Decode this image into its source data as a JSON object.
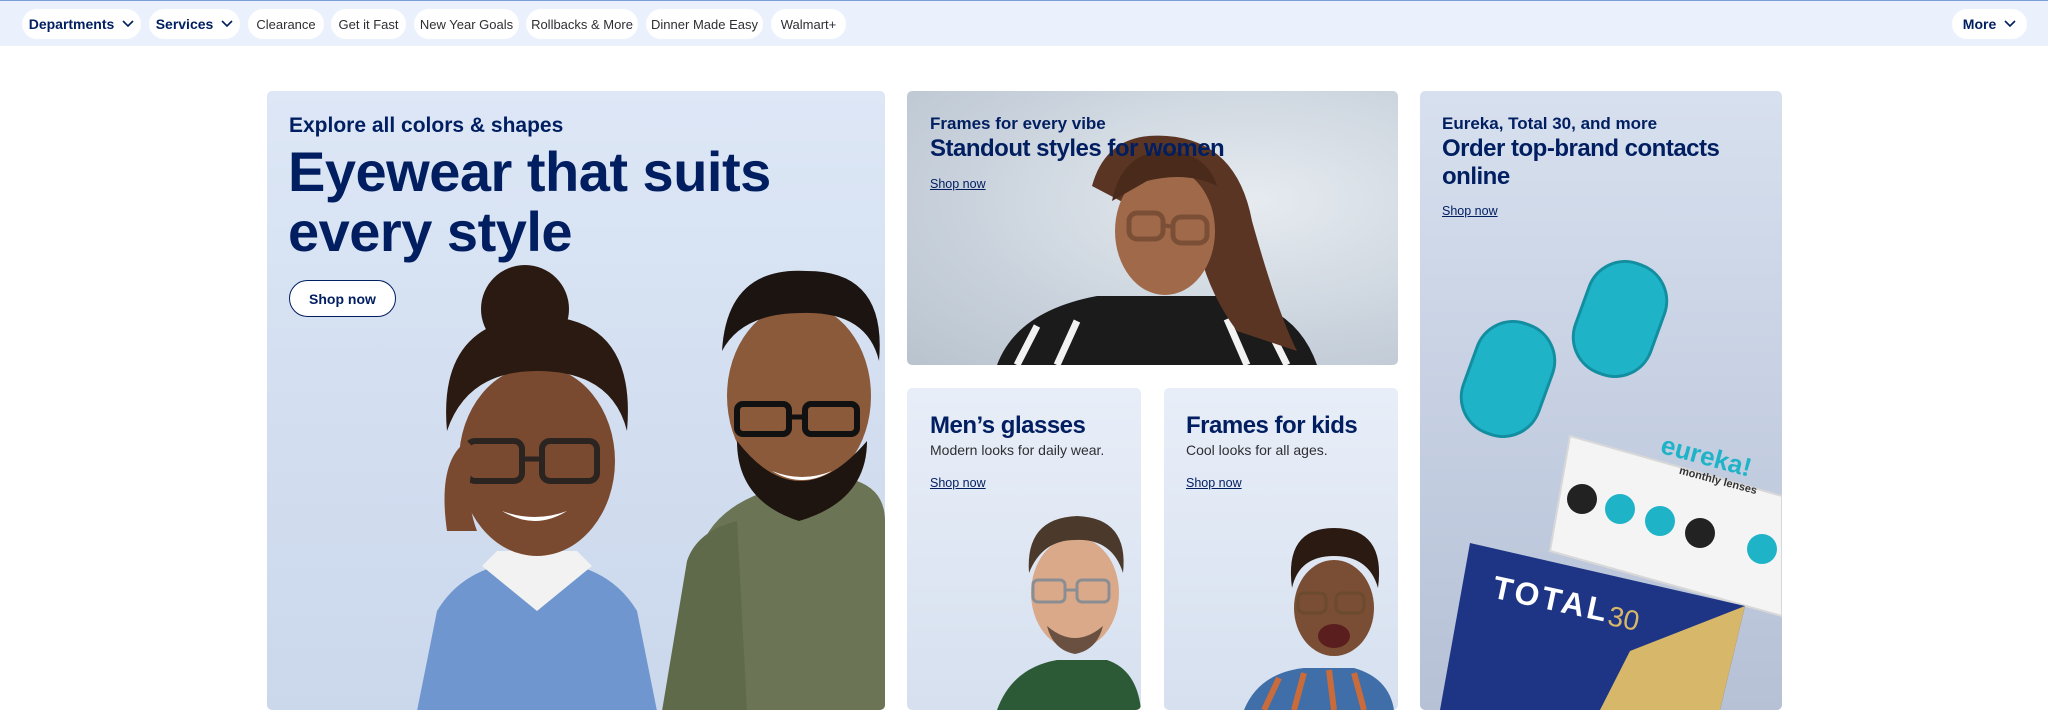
{
  "nav": {
    "departments": "Departments",
    "services": "Services",
    "links": [
      "Clearance",
      "Get it Fast",
      "New Year Goals",
      "Rollbacks & More",
      "Dinner Made Easy",
      "Walmart+"
    ],
    "more": "More"
  },
  "hero": {
    "eyebrow": "Explore all colors & shapes",
    "title_line1": "Eyewear that suits",
    "title_line2": "every style",
    "cta": "Shop now"
  },
  "women": {
    "eyebrow": "Frames for every vibe",
    "title": "Standout styles for women",
    "link": "Shop now"
  },
  "men": {
    "title": "Men’s glasses",
    "subtitle": "Modern looks for daily wear.",
    "link": "Shop now"
  },
  "kids": {
    "title": "Frames for kids",
    "subtitle": "Cool looks for all ages.",
    "link": "Shop now"
  },
  "contacts": {
    "eyebrow": "Eureka, Total 30, and more",
    "title_line1": "Order top-brand contacts",
    "title_line2": "online",
    "link": "Shop now",
    "box_brand": "eureka!",
    "box_sub": "monthly lenses",
    "total_brand": "TOTAL",
    "total_num": "30"
  },
  "colors": {
    "navy": "#001e60",
    "nav_bg": "#eaf1fc",
    "lens_teal": "#1fb3c8"
  }
}
